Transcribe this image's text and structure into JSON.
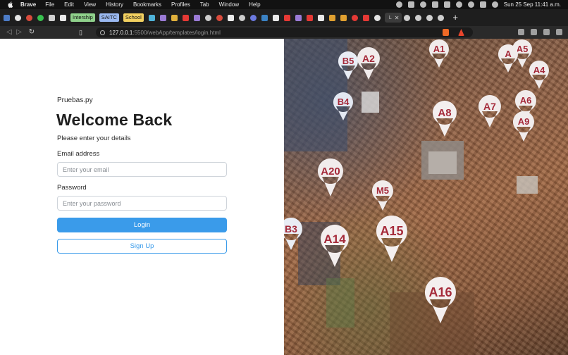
{
  "menubar": {
    "app": "Brave",
    "menus": [
      "File",
      "Edit",
      "View",
      "History",
      "Bookmarks",
      "Profiles",
      "Tab",
      "Window",
      "Help"
    ],
    "clock": "Sun 25 Sep  11:41 a.m."
  },
  "tabs": {
    "chips": [
      {
        "label": "Intership",
        "color": "#8fd18b"
      },
      {
        "label": "SAITC",
        "color": "#9ab8f0"
      },
      {
        "label": "School",
        "color": "#f2d060"
      }
    ],
    "active_label": "L"
  },
  "address": {
    "host": "127.0.0.1",
    "path": ":5500/webApp/templates/login.html"
  },
  "login": {
    "brand": "Pruebas.py",
    "title": "Welcome Back",
    "subtitle": "Please enter your details",
    "email_label": "Email address",
    "email_placeholder": "Enter your email",
    "password_label": "Password",
    "password_placeholder": "Enter your password",
    "login_button": "Login",
    "signup_button": "Sign Up"
  },
  "hero": {
    "pins": [
      "A1",
      "A5",
      "B5",
      "A2",
      "A",
      "A4",
      "B4",
      "A8",
      "A7",
      "A6",
      "A9",
      "A20",
      "M5",
      "B3",
      "A14",
      "A15",
      "A16"
    ]
  },
  "colors": {
    "accent": "#3a9bea",
    "menubar": "#121212",
    "tabstrip": "#1e1e1e"
  }
}
